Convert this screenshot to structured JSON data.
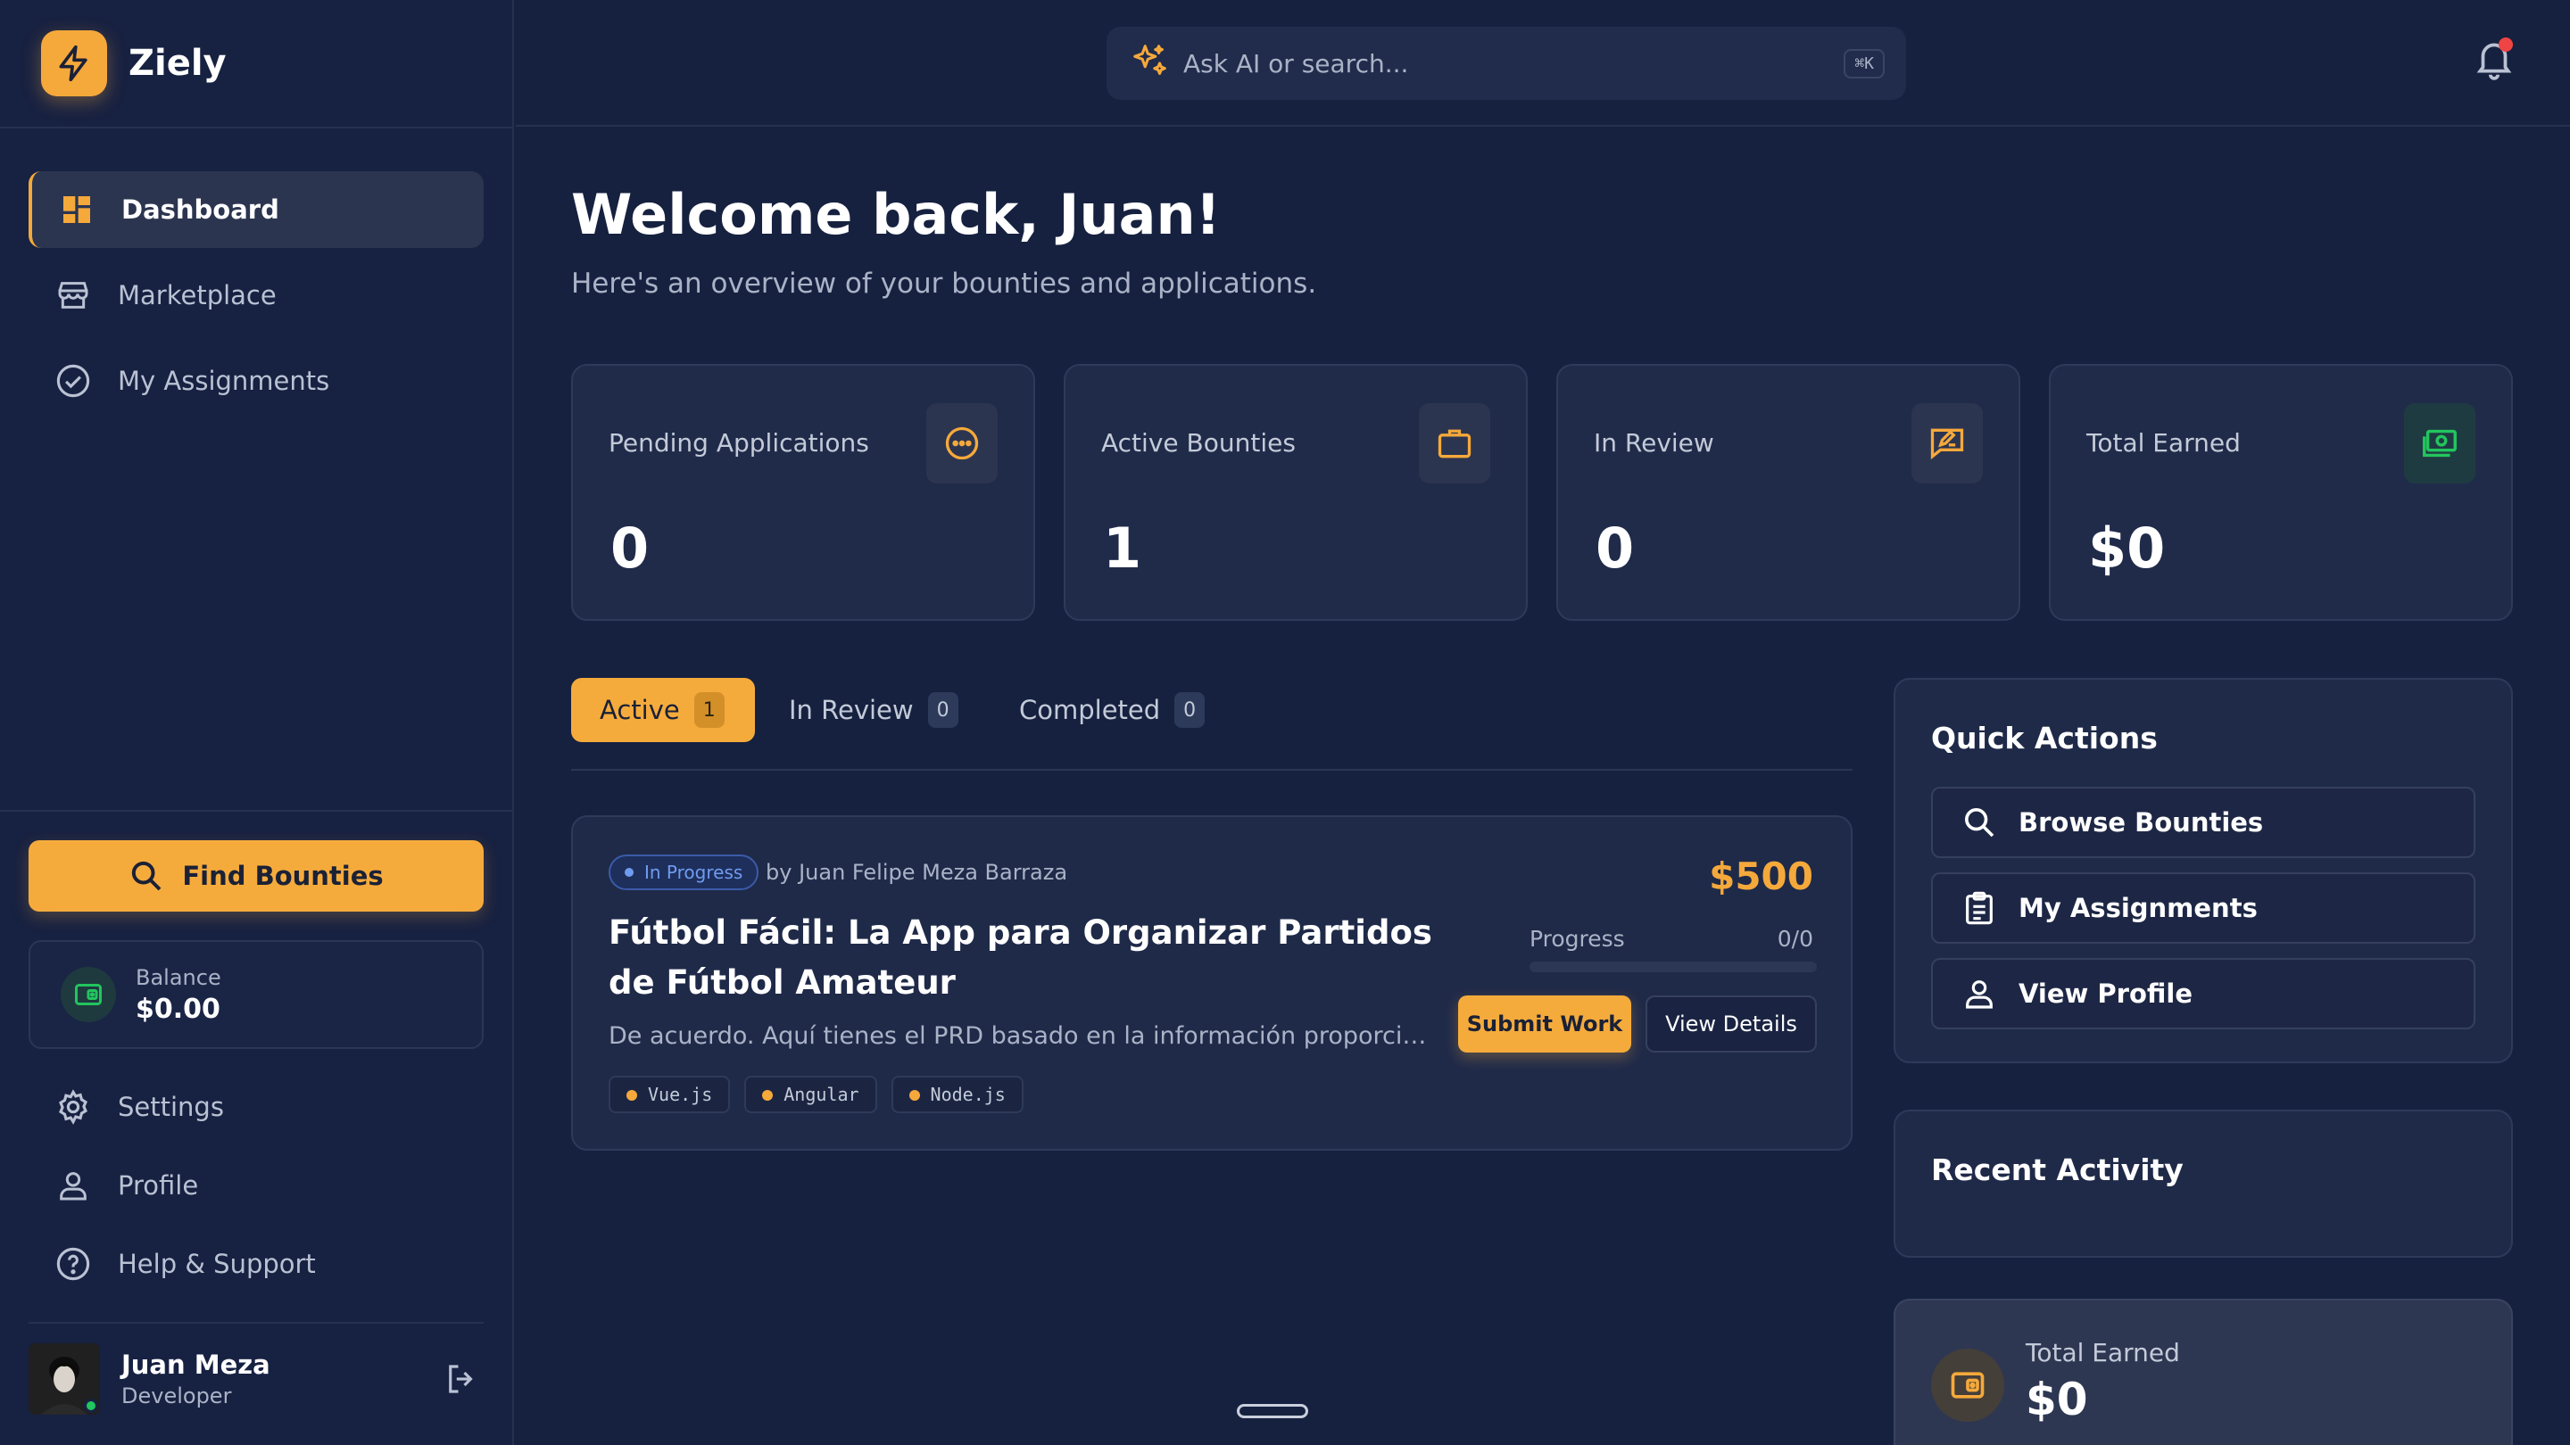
{
  "app": {
    "name": "Ziely"
  },
  "sidebar": {
    "items": [
      {
        "label": "Dashboard",
        "icon": "dashboard-icon",
        "active": true
      },
      {
        "label": "Marketplace",
        "icon": "store-icon",
        "active": false
      },
      {
        "label": "My Assignments",
        "icon": "check-circle-icon",
        "active": false
      }
    ],
    "find_bounties_label": "Find Bounties",
    "balance": {
      "label": "Balance",
      "value": "$0.00"
    },
    "bottom_items": [
      {
        "label": "Settings",
        "icon": "gear-icon"
      },
      {
        "label": "Profile",
        "icon": "user-icon"
      },
      {
        "label": "Help & Support",
        "icon": "help-icon"
      }
    ],
    "user": {
      "name": "Juan Meza",
      "role": "Developer"
    }
  },
  "header": {
    "search_placeholder": "Ask AI or search...",
    "shortcut": "⌘K"
  },
  "main": {
    "title": "Welcome back, Juan!",
    "subtitle": "Here's an overview of your bounties and applications.",
    "stats": [
      {
        "label": "Pending Applications",
        "value": "0",
        "icon": "chat-dots-icon"
      },
      {
        "label": "Active Bounties",
        "value": "1",
        "icon": "briefcase-icon"
      },
      {
        "label": "In Review",
        "value": "0",
        "icon": "review-icon"
      },
      {
        "label": "Total Earned",
        "value": "$0",
        "icon": "money-icon"
      }
    ],
    "tabs": [
      {
        "label": "Active",
        "count": "1",
        "active": true
      },
      {
        "label": "In Review",
        "count": "0",
        "active": false
      },
      {
        "label": "Completed",
        "count": "0",
        "active": false
      }
    ],
    "bounty": {
      "status": "In Progress",
      "author": "by Juan Felipe Meza Barraza",
      "title": "Fútbol Fácil: La App para Organizar Partidos de Fútbol Amateur",
      "description": "De acuerdo. Aquí tienes el PRD basado en la información proporcionad...",
      "tags": [
        "Vue.js",
        "Angular",
        "Node.js"
      ],
      "price": "$500",
      "progress_label": "Progress",
      "progress_value": "0/0",
      "progress_fraction": 0,
      "submit_label": "Submit Work",
      "details_label": "View Details"
    }
  },
  "quick_actions": {
    "title": "Quick Actions",
    "items": [
      {
        "label": "Browse Bounties",
        "icon": "search-icon"
      },
      {
        "label": "My Assignments",
        "icon": "clipboard-icon"
      },
      {
        "label": "View Profile",
        "icon": "user-icon"
      }
    ]
  },
  "recent_activity": {
    "title": "Recent Activity"
  },
  "total_earned_card": {
    "label": "Total Earned",
    "value": "$0"
  },
  "colors": {
    "accent": "#f5a93b",
    "background": "#162140",
    "card": "#1f2a49",
    "success": "#22c55e",
    "info": "#6f9cf0"
  }
}
